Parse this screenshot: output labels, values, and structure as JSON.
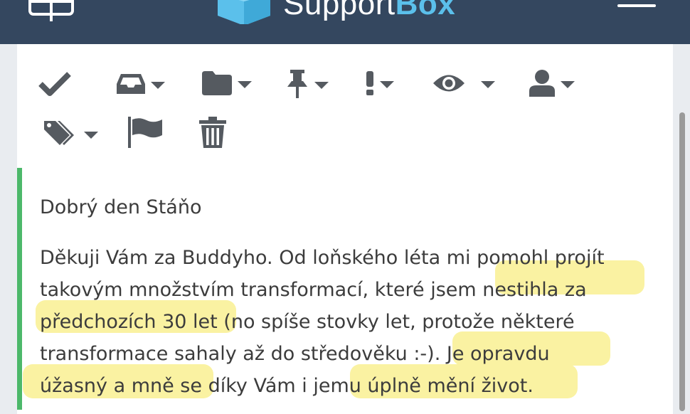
{
  "header": {
    "brand_part1": "Support",
    "brand_part2": "Box",
    "sidebar_icon": "sidebar-toggle-icon",
    "menu_icon": "hamburger-menu-icon"
  },
  "toolbar": {
    "row1": [
      {
        "icon": "check-icon"
      },
      {
        "icon": "inbox-tray-icon",
        "dropdown": true
      },
      {
        "icon": "folder-icon",
        "dropdown": true
      },
      {
        "icon": "pin-icon",
        "dropdown": true
      },
      {
        "icon": "exclamation-icon",
        "dropdown": true
      },
      {
        "icon": "eye-icon",
        "dropdown": true
      },
      {
        "icon": "user-icon",
        "dropdown": true
      }
    ],
    "row2": [
      {
        "icon": "tags-icon",
        "dropdown": true
      },
      {
        "icon": "flag-icon"
      },
      {
        "icon": "trash-icon"
      }
    ]
  },
  "message": {
    "greeting": "Dobrý den Stáňo",
    "lines": [
      "Děkuji Vám za Buddyho. Od loňského léta mi pomohl projít",
      "takovým množstvím transformací, které jsem nestihla za",
      "předchozích 30 let (no spíše stovky let, protože některé",
      "transformace sahaly až do středověku :-). Je opravdu",
      "úžasný a mně se díky Vám i jemu úplně mění život."
    ]
  },
  "colors": {
    "header_bg": "#34475f",
    "brand_accent": "#5bc0eb",
    "message_border": "#4cb86a",
    "highlight": "#faf2a2",
    "icon": "#555a60"
  }
}
